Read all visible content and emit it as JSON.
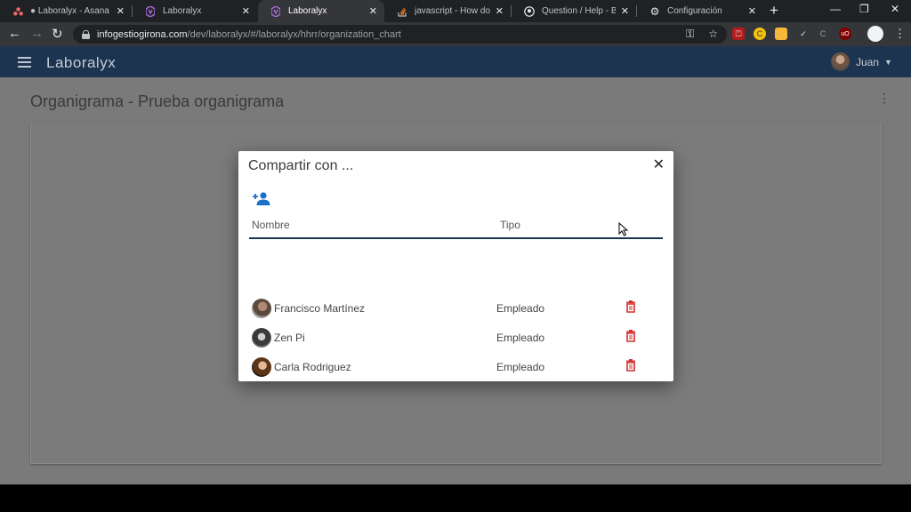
{
  "browser": {
    "tabs": [
      {
        "title": "● Laboralyx - Asana",
        "icon": "asana-icon",
        "active": false
      },
      {
        "title": "Laboralyx",
        "icon": "laboralyx-icon",
        "active": false
      },
      {
        "title": "Laboralyx",
        "icon": "laboralyx-icon",
        "active": true
      },
      {
        "title": "javascript - How do I re",
        "icon": "stackoverflow-icon",
        "active": false
      },
      {
        "title": "Question / Help - Black",
        "icon": "github-icon",
        "active": false
      },
      {
        "title": "Configuración",
        "icon": "gear-icon",
        "active": false
      }
    ],
    "url_host": "infogestiogirona.com",
    "url_path": "/dev/laboralyx/#/laboralyx/hhrr/organization_chart"
  },
  "app": {
    "brand": "Laboralyx",
    "user_name": "Juan",
    "colors": {
      "appbar": "#1c344f",
      "delete": "#d32f2f",
      "accent": "#1c344f"
    }
  },
  "page": {
    "title": "Organigrama - Prueba organigrama"
  },
  "dialog": {
    "title": "Compartir con ...",
    "columns": {
      "name": "Nombre",
      "type": "Tipo"
    },
    "rows": [
      {
        "name": "Francisco Martínez",
        "type": "Empleado"
      },
      {
        "name": "Zen Pi",
        "type": "Empleado"
      },
      {
        "name": "Carla Rodriguez",
        "type": "Empleado"
      }
    ]
  }
}
